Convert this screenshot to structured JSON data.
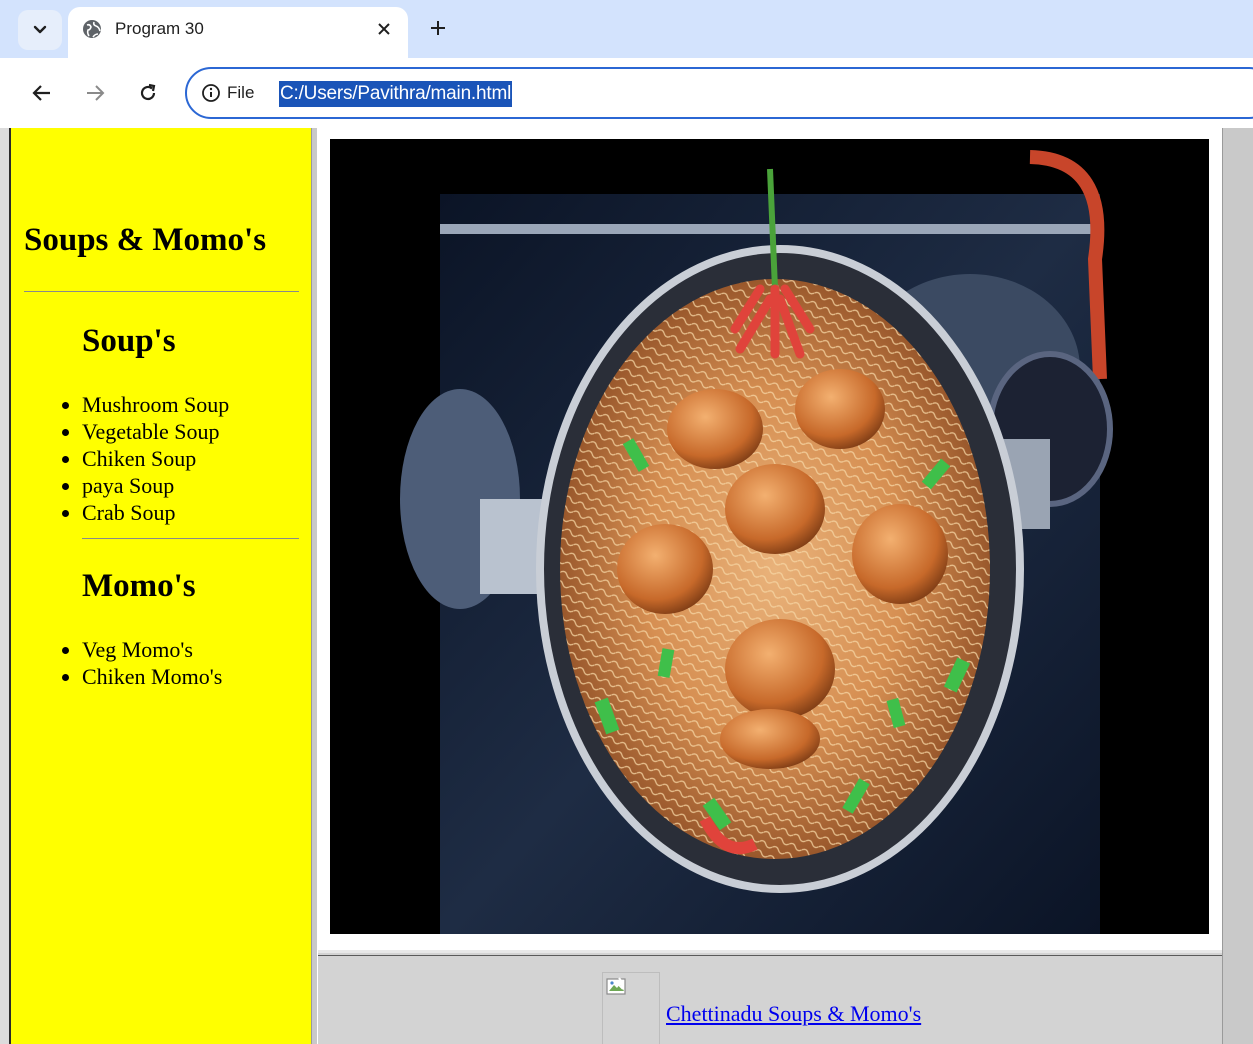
{
  "browser": {
    "tab_title": "Program 30",
    "site_info_label": "File",
    "url": "C:/Users/Pavithra/main.html"
  },
  "sidebar": {
    "title": "Soups & Momo's",
    "soups_heading": "Soup's",
    "soups": [
      "Mushroom Soup",
      "Vegetable Soup",
      "Chiken Soup",
      "paya Soup",
      "Crab Soup"
    ],
    "momos_heading": "Momo's",
    "momos": [
      "Veg Momo's",
      "Chiken Momo's"
    ]
  },
  "footer": {
    "link_text": "Chettinadu Soups & Momo's"
  },
  "colors": {
    "sidebar_bg": "#ffff00",
    "tabstrip_bg": "#d3e3fd",
    "url_highlight": "#1a54b8",
    "link": "#0000ee",
    "frame_bg": "#d3d3d3"
  },
  "icons": {
    "tab_search": "chevron-down-icon",
    "favicon": "globe-icon",
    "tab_close": "close-icon",
    "new_tab": "plus-icon",
    "back": "arrow-left-icon",
    "forward": "arrow-right-icon",
    "reload": "reload-icon",
    "site_info": "info-icon",
    "broken_image": "broken-image-icon"
  }
}
